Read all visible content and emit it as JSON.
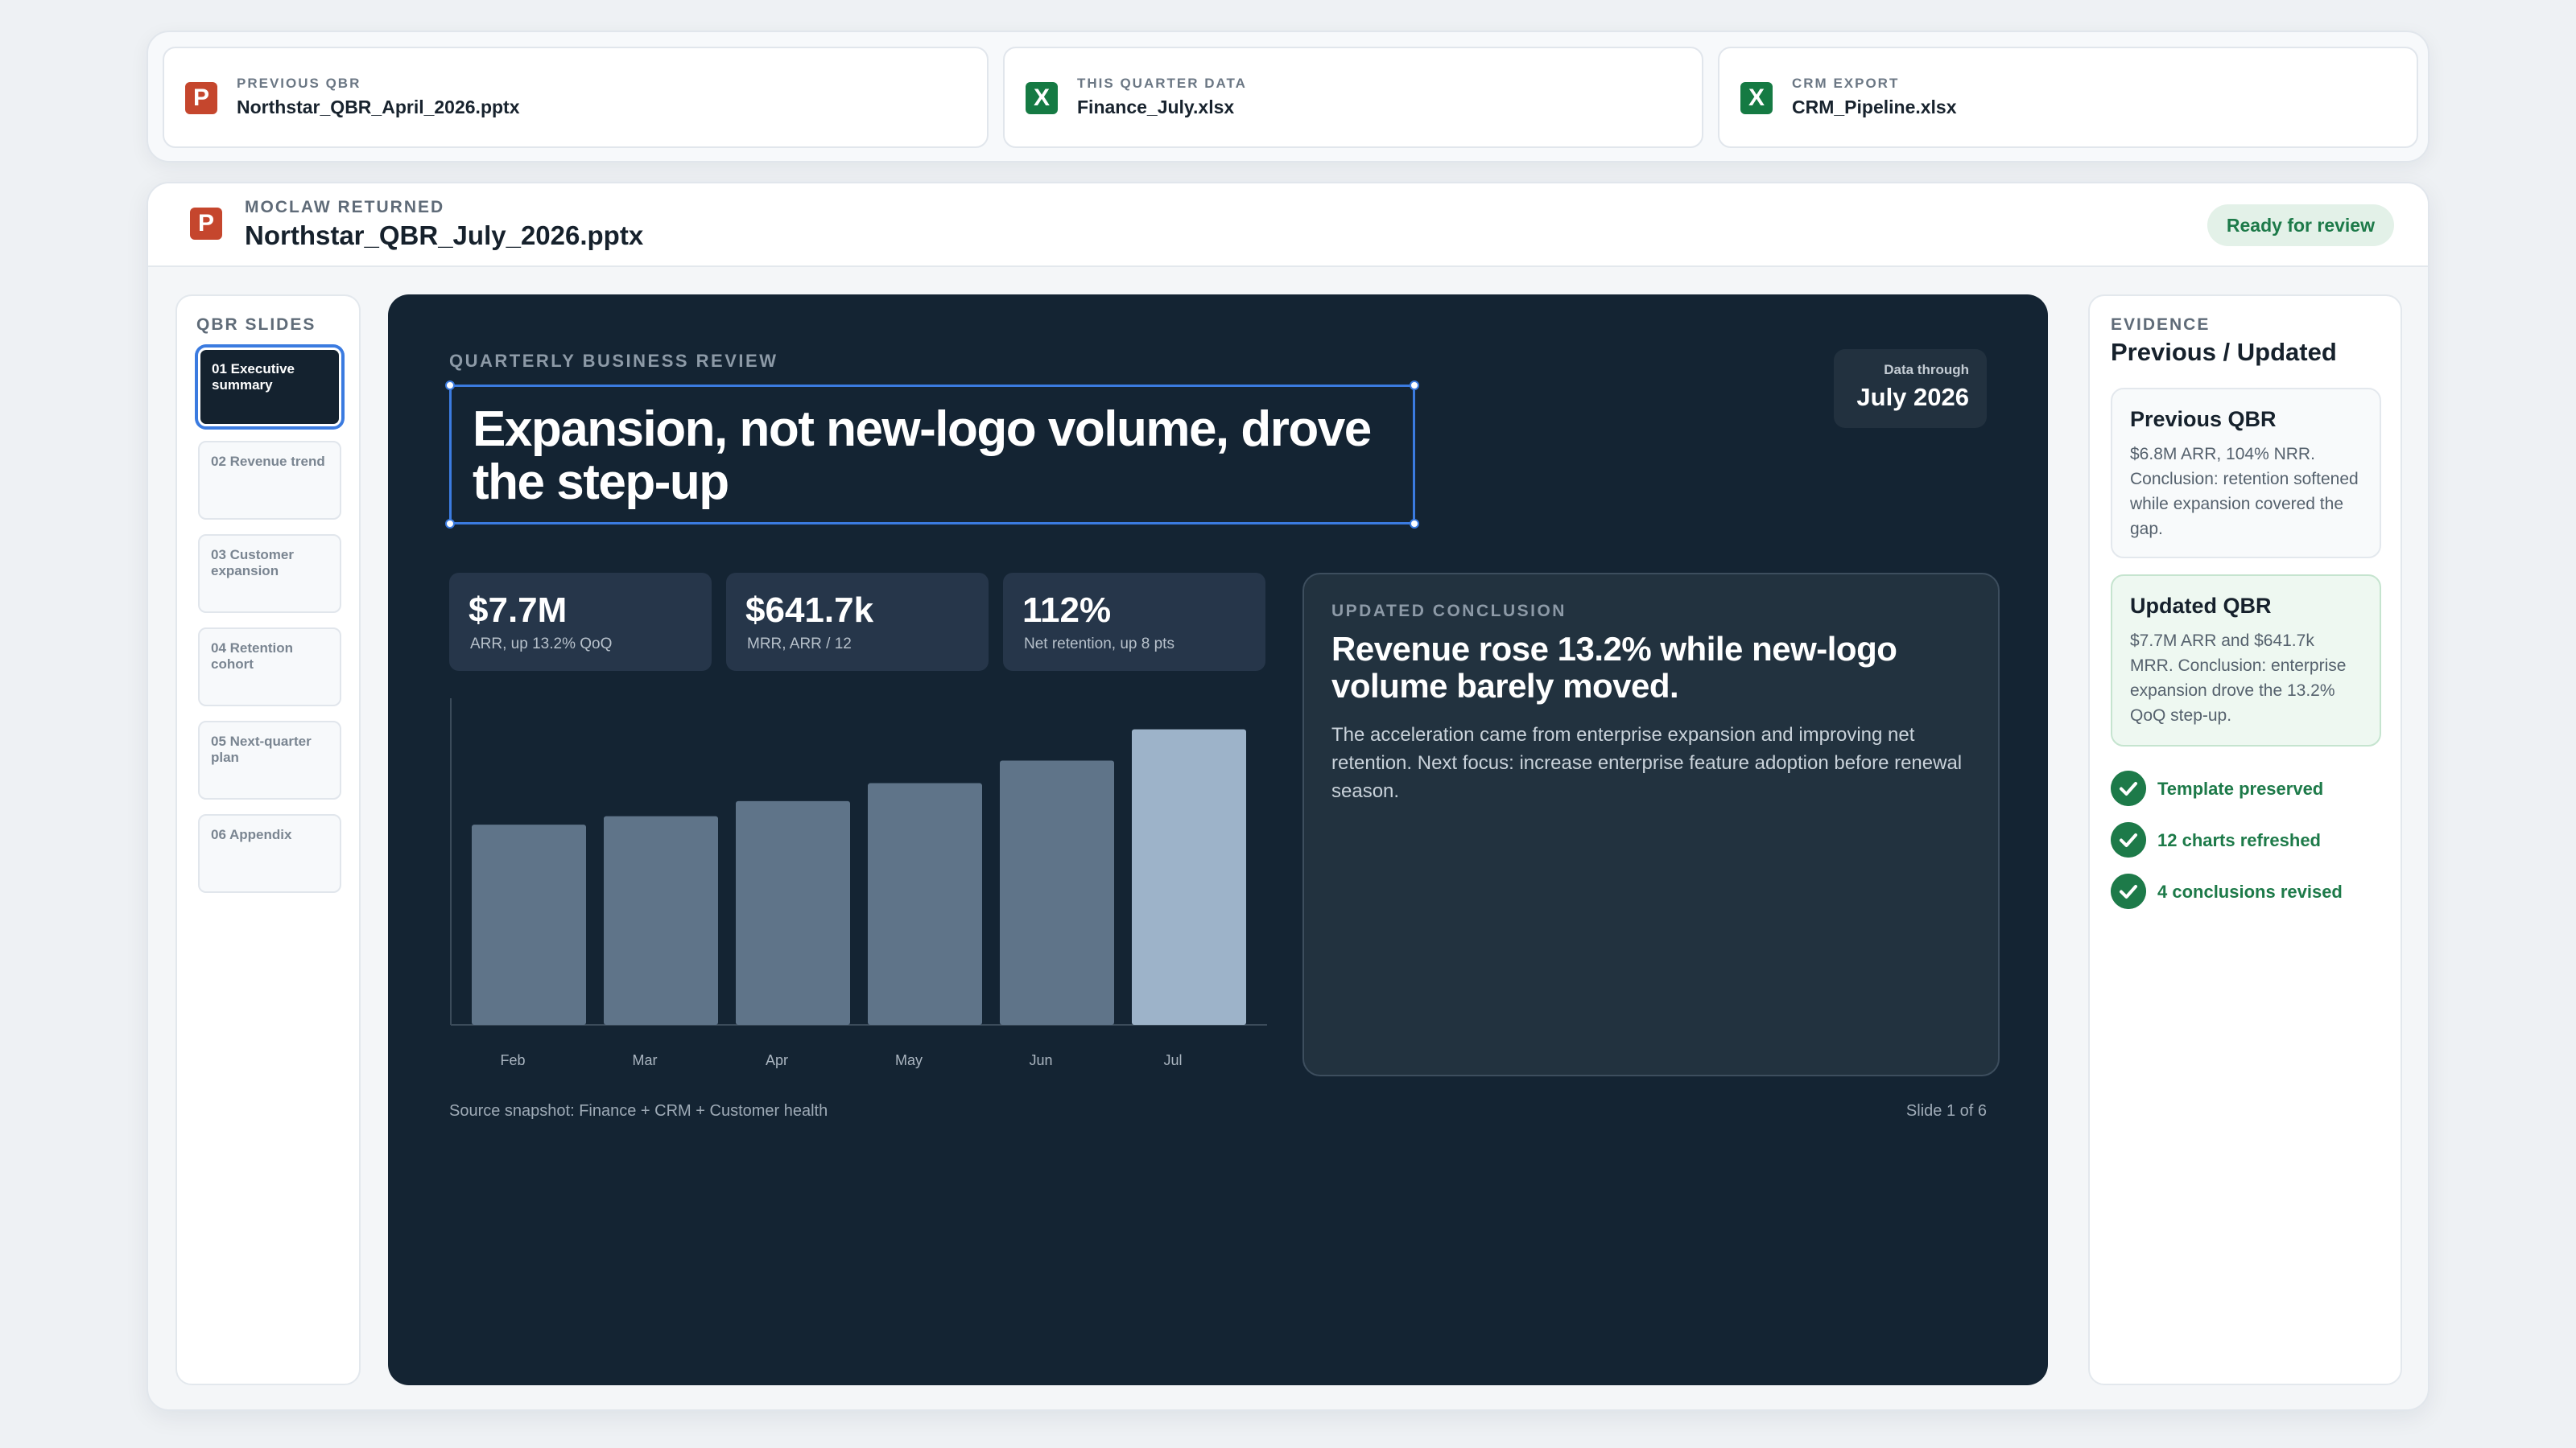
{
  "source_files": [
    {
      "kicker": "PREVIOUS QBR",
      "name": "Northstar_QBR_April_2026.pptx",
      "icon": "powerpoint-icon",
      "icon_letter": "P"
    },
    {
      "kicker": "THIS QUARTER DATA",
      "name": "Finance_July.xlsx",
      "icon": "excel-icon",
      "icon_letter": "X"
    },
    {
      "kicker": "CRM EXPORT",
      "name": "CRM_Pipeline.xlsx",
      "icon": "excel-icon",
      "icon_letter": "X"
    }
  ],
  "result": {
    "kicker": "MOCLAW RETURNED",
    "file_name": "Northstar_QBR_July_2026.pptx",
    "icon_letter": "P",
    "status": "Ready for review"
  },
  "slides_rail": {
    "title": "QBR SLIDES",
    "items": [
      {
        "label": "01 Executive summary"
      },
      {
        "label": "02 Revenue trend"
      },
      {
        "label": "03 Customer expansion"
      },
      {
        "label": "04 Retention cohort"
      },
      {
        "label": "05 Next-quarter plan"
      },
      {
        "label": "06 Appendix"
      }
    ]
  },
  "slide": {
    "kicker": "QUARTERLY BUSINESS REVIEW",
    "headline": "Expansion, not new-logo volume, drove the step-up",
    "date_label": "Data through",
    "date_value": "July 2026",
    "kpis": [
      {
        "value": "$7.7M",
        "caption": "ARR, up 13.2% QoQ"
      },
      {
        "value": "$641.7k",
        "caption": "MRR, ARR / 12"
      },
      {
        "value": "112%",
        "caption": "Net retention, up 8 pts"
      }
    ],
    "conclusion": {
      "kicker": "UPDATED CONCLUSION",
      "title": "Revenue rose 13.2% while new-logo volume barely moved.",
      "body": "The acceleration came from enterprise expansion and improving net retention. Next focus: increase enterprise feature adoption before renewal season."
    },
    "source": "Source snapshot: Finance + CRM + Customer health",
    "page": "Slide 1 of 6"
  },
  "chart_data": {
    "type": "bar",
    "categories": [
      "Feb",
      "Mar",
      "Apr",
      "May",
      "Jun",
      "Jul"
    ],
    "values": [
      6.13,
      6.39,
      6.85,
      7.4,
      8.09,
      9.05
    ],
    "ylim": [
      0,
      10
    ],
    "grid": false,
    "colors": {
      "default": "#5f7489",
      "highlight": "#9db3c9",
      "axis": "#3b4b5a",
      "label": "#aab5c0"
    },
    "highlight_index": 5
  },
  "evidence": {
    "kicker": "EVIDENCE",
    "title": "Previous / Updated",
    "previous": {
      "title": "Previous QBR",
      "body": "$6.8M ARR, 104% NRR. Conclusion: retention softened while expansion covered the gap."
    },
    "updated": {
      "title": "Updated QBR",
      "body": "$7.7M ARR and $641.7k MRR. Conclusion: enterprise expansion drove the 13.2% QoQ step-up."
    },
    "checks": [
      {
        "label": "Template preserved"
      },
      {
        "label": "12 charts refreshed"
      },
      {
        "label": "4 conclusions revised"
      }
    ]
  },
  "colors": {
    "accent_blue": "#3b7be0",
    "slide_bg": "#142433",
    "success_green": "#1d7a49",
    "ppt_red": "#c5462d",
    "xls_green": "#157a43"
  }
}
